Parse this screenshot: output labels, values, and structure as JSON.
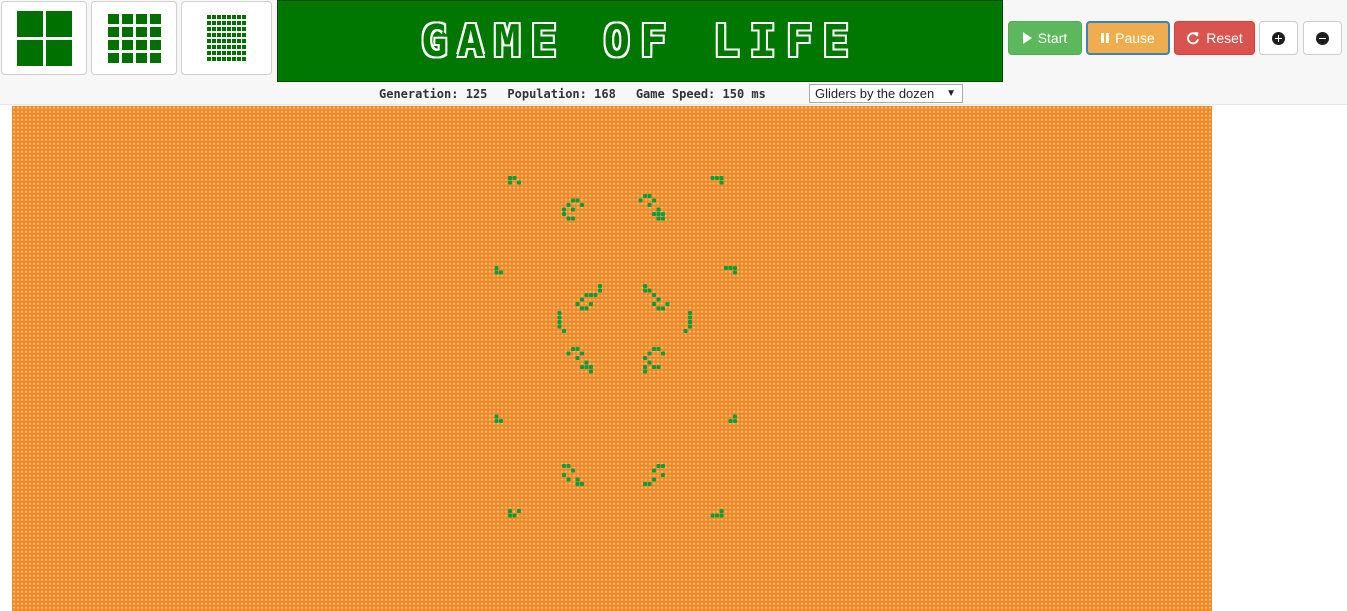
{
  "title": "GAME OF LIFE",
  "controls": {
    "start": "Start",
    "pause": "Pause",
    "reset": "Reset"
  },
  "status": {
    "generation_label": "Generation:",
    "generation": "125",
    "population_label": "Population:",
    "population": "168",
    "speed_label": "Game Speed:",
    "speed": "150 ms"
  },
  "pattern_select": {
    "selected": "Gliders by the dozen"
  },
  "cell_sizes": [
    "large",
    "medium",
    "small"
  ],
  "colors": {
    "banner": "#007700",
    "alive": "#00a03c",
    "dead": "#ef8a2a",
    "start": "#5cb85c",
    "pause": "#f0ad4e",
    "reset": "#d9534f"
  },
  "grid": {
    "columns": 266,
    "rows": 112
  }
}
